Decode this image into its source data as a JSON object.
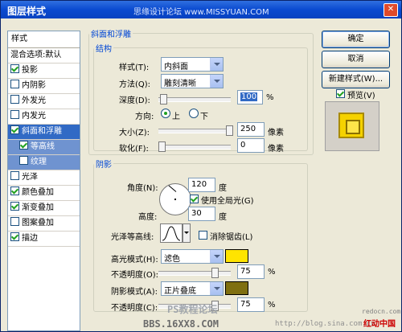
{
  "window": {
    "title": "图层样式",
    "watermark": "思缘设计论坛 www.MISSYUAN.COM"
  },
  "left_panel": {
    "header": "样式",
    "items": [
      {
        "label": "混合选项:默认",
        "checkbox": false,
        "checked": false,
        "selected": false
      },
      {
        "label": "投影",
        "checkbox": true,
        "checked": true,
        "selected": false
      },
      {
        "label": "内阴影",
        "checkbox": true,
        "checked": false,
        "selected": false
      },
      {
        "label": "外发光",
        "checkbox": true,
        "checked": false,
        "selected": false
      },
      {
        "label": "内发光",
        "checkbox": true,
        "checked": false,
        "selected": false
      },
      {
        "label": "斜面和浮雕",
        "checkbox": true,
        "checked": true,
        "selected": true
      },
      {
        "label": "等高线",
        "checkbox": true,
        "checked": true,
        "selected": true,
        "sub": true
      },
      {
        "label": "纹理",
        "checkbox": true,
        "checked": false,
        "selected": true,
        "sub": true
      },
      {
        "label": "光泽",
        "checkbox": true,
        "checked": false,
        "selected": false
      },
      {
        "label": "颜色叠加",
        "checkbox": true,
        "checked": true,
        "selected": false
      },
      {
        "label": "渐变叠加",
        "checkbox": true,
        "checked": true,
        "selected": false
      },
      {
        "label": "图案叠加",
        "checkbox": true,
        "checked": false,
        "selected": false
      },
      {
        "label": "描边",
        "checkbox": true,
        "checked": true,
        "selected": false
      }
    ]
  },
  "bevel": {
    "section_title": "斜面和浮雕",
    "structure_title": "结构",
    "style_label": "样式(T):",
    "style_value": "内斜面",
    "technique_label": "方法(Q):",
    "technique_value": "雕刻清晰",
    "depth_label": "深度(D):",
    "depth_value": "100",
    "depth_unit": "%",
    "direction_label": "方向:",
    "dir_up": "上",
    "dir_down": "下",
    "size_label": "大小(Z):",
    "size_value": "250",
    "size_unit": "像素",
    "soften_label": "软化(F):",
    "soften_value": "0",
    "soften_unit": "像素"
  },
  "shading": {
    "title": "阴影",
    "angle_label": "角度(N):",
    "angle_value": "120",
    "angle_unit": "度",
    "global_light_label": "使用全局光(G)",
    "global_light_checked": true,
    "altitude_label": "高度:",
    "altitude_value": "30",
    "altitude_unit": "度",
    "gloss_label": "光泽等高线:",
    "antialias_label": "消除锯齿(L)",
    "antialias_checked": false,
    "highlight_mode_label": "高光模式(H):",
    "highlight_mode_value": "滤色",
    "highlight_color": "#ffe400",
    "highlight_opacity_label": "不透明度(O):",
    "highlight_opacity_value": "75",
    "highlight_opacity_unit": "%",
    "shadow_mode_label": "阴影模式(A):",
    "shadow_mode_value": "正片叠底",
    "shadow_color": "#7f6f10",
    "shadow_opacity_label": "不透明度(C):",
    "shadow_opacity_value": "75",
    "shadow_opacity_unit": "%"
  },
  "buttons": {
    "ok": "确定",
    "cancel": "取消",
    "new_style": "新建样式(W)...",
    "preview_label": "预览(V)",
    "preview_checked": true
  },
  "watermarks": {
    "bbs": "BBS.16XX8.COM",
    "ps": "PS教程论坛",
    "url": "http://blog.sina.com.cn",
    "redocn": "redocn.com",
    "red": "红动中国"
  }
}
